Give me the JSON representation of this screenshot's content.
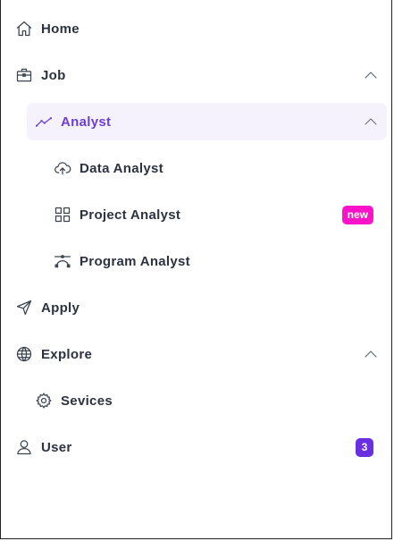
{
  "nav": {
    "home": {
      "label": "Home",
      "icon": "home-icon"
    },
    "job": {
      "label": "Job",
      "icon": "briefcase-icon"
    },
    "analyst": {
      "label": "Analyst",
      "icon": "trend-line-icon"
    },
    "data_analyst": {
      "label": "Data Analyst",
      "icon": "cloud-upload-icon"
    },
    "project_analyst": {
      "label": "Project Analyst",
      "icon": "grid-icon",
      "badge": "new"
    },
    "program_analyst": {
      "label": "Program Analyst",
      "icon": "bezier-curve-icon"
    },
    "apply": {
      "label": "Apply",
      "icon": "send-icon"
    },
    "explore": {
      "label": "Explore",
      "icon": "globe-icon"
    },
    "services": {
      "label": "Sevices",
      "icon": "gear-icon"
    },
    "user": {
      "label": "User",
      "icon": "user-icon",
      "badge": "3"
    }
  },
  "colors": {
    "accent": "#6b3fd6",
    "active_bg": "#f5f2fd",
    "badge_new": "#ff12c8",
    "badge_count": "#6a2fe0",
    "text": "#2b3340"
  }
}
